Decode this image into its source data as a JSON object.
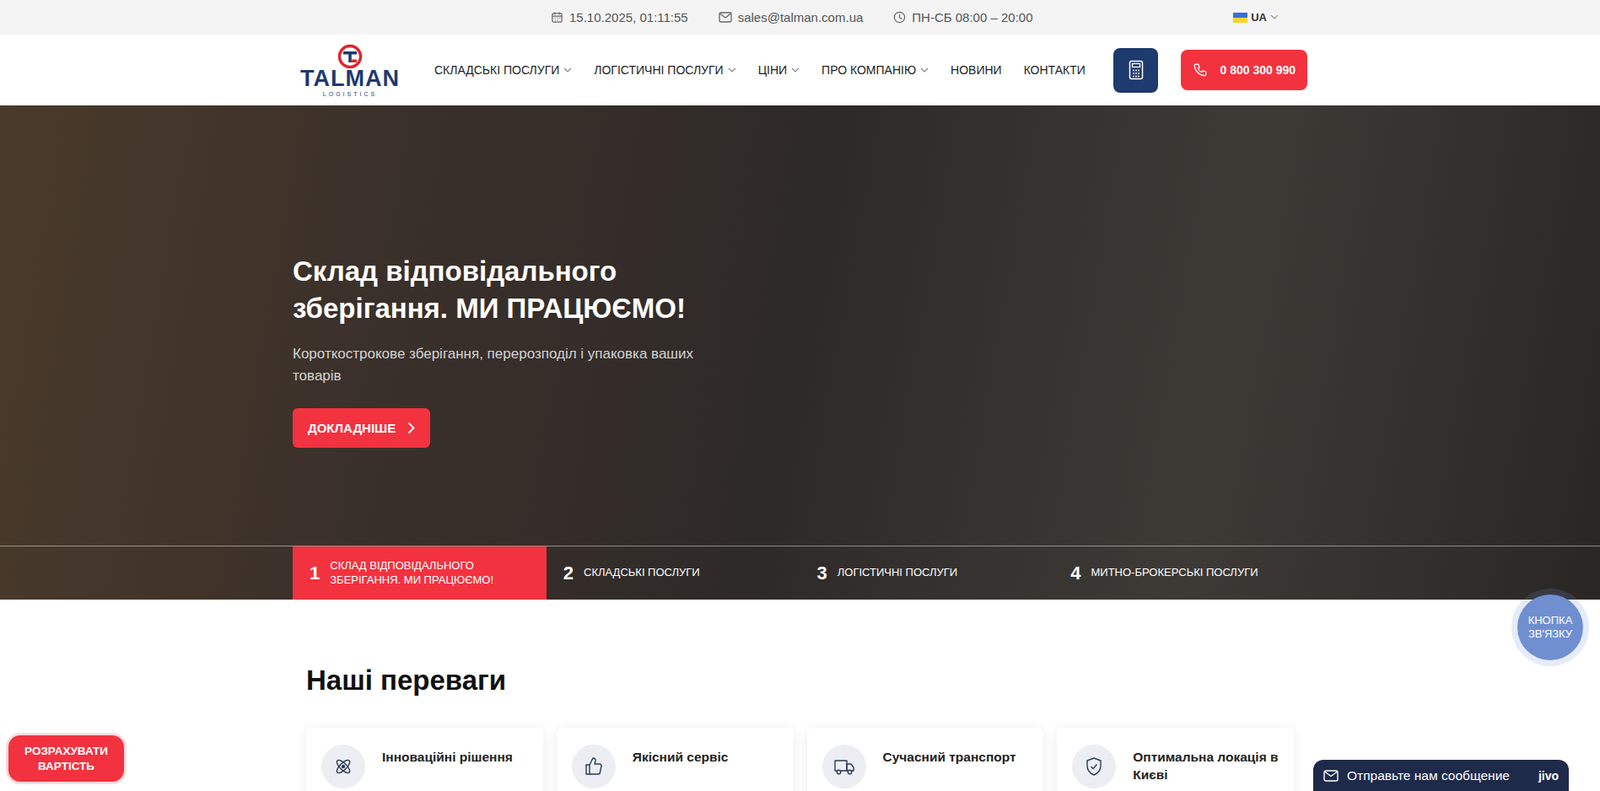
{
  "topbar": {
    "datetime": "15.10.2025, 01:11:55",
    "email": "sales@talman.com.ua",
    "hours": "ПН-СБ 08:00 – 20:00",
    "language": "UA"
  },
  "logo": {
    "name": "TALMAN",
    "tagline": "LOGISTICS"
  },
  "nav": [
    {
      "label": "СКЛАДСЬКІ ПОСЛУГИ",
      "dropdown": true
    },
    {
      "label": "ЛОГІСТИЧНІ ПОСЛУГИ",
      "dropdown": true
    },
    {
      "label": "ЦІНИ",
      "dropdown": true
    },
    {
      "label": "ПРО КОМПАНІЮ",
      "dropdown": true
    },
    {
      "label": "НОВИНИ",
      "dropdown": false
    },
    {
      "label": "КОНТАКТИ",
      "dropdown": false
    }
  ],
  "phone": "0 800 300 990",
  "hero": {
    "title_lines": [
      "Склад відповідального",
      "зберігання. МИ ПРАЦЮЄМО!"
    ],
    "subtitle": "Короткострокове зберігання, перерозподіл і упаковка ваших товарів",
    "button": "ДОКЛАДНІШЕ"
  },
  "slides": [
    {
      "number": "1",
      "label": "СКЛАД ВІДПОВІДАЛЬНОГО ЗБЕРІГАННЯ. МИ ПРАЦЮЄМО!",
      "selected": true
    },
    {
      "number": "2",
      "label": "СКЛАДСЬКІ ПОСЛУГИ",
      "selected": false
    },
    {
      "number": "3",
      "label": "ЛОГІСТИЧНІ ПОСЛУГИ",
      "selected": false
    },
    {
      "number": "4",
      "label": "МИТНО-БРОКЕРСЬКІ ПОСЛУГИ",
      "selected": false
    }
  ],
  "contact_button": "КНОПКА ЗВ'ЯЗКУ",
  "advantages": {
    "title": "Наші переваги",
    "items": [
      {
        "label": "Інноваційні рішення",
        "kind": "atom"
      },
      {
        "label": "Якісний сервіс",
        "kind": "thumb"
      },
      {
        "label": "Сучасний транспорт",
        "kind": "truck"
      },
      {
        "label": "Оптимальна локація в Києві",
        "kind": "shield"
      }
    ]
  },
  "calc_button": "РОЗРАХУВАТИ ВАРТІСТЬ",
  "chat": {
    "label": "Отправьте нам сообщение",
    "brand": "jivo"
  }
}
